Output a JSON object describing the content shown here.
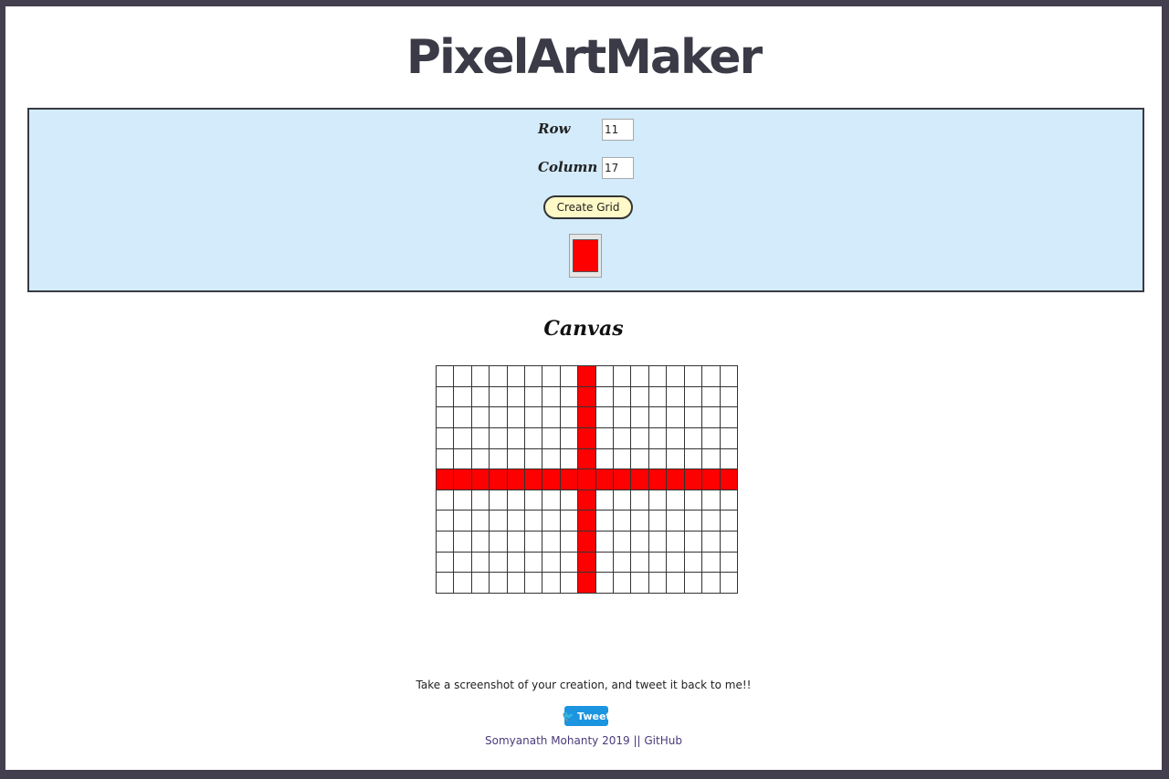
{
  "header": {
    "title": "PixelArtMaker"
  },
  "controls": {
    "row_label": "Row",
    "row_value": "11",
    "column_label": "Column",
    "column_value": "17",
    "create_button_label": "Create Grid",
    "selected_color": "#ff0000"
  },
  "canvas": {
    "heading": "Canvas",
    "rows": 11,
    "columns": 17,
    "fill_color": "#ff0000",
    "filled_row": 6,
    "filled_column": 9
  },
  "footer": {
    "message": "Take a screenshot of your creation, and tweet it back to me!!",
    "tweet_label": "Tweet",
    "tweet_icon": "twitter-bird-icon",
    "author": "Somyanath Mohanty 2019",
    "separator": "||",
    "github_label": "GitHub"
  }
}
